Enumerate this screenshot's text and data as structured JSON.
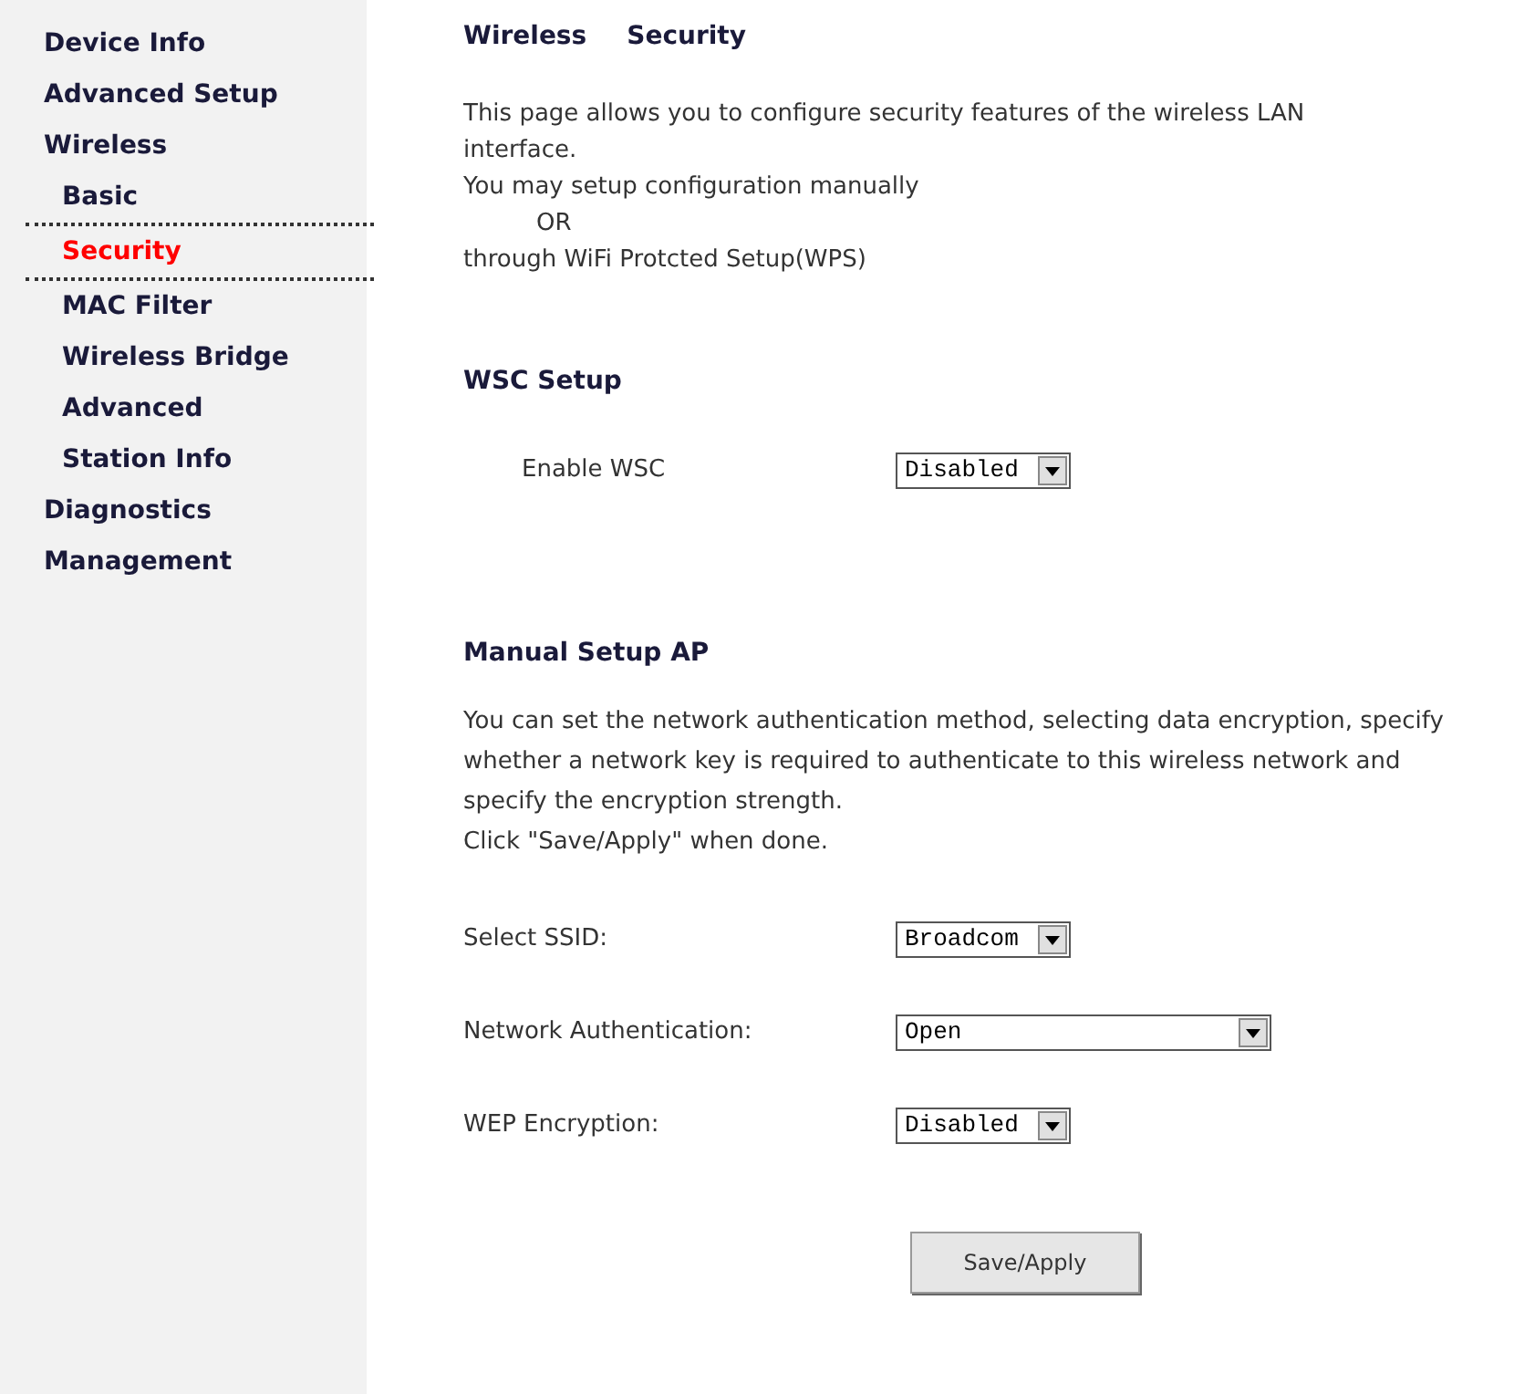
{
  "sidebar": {
    "items": [
      {
        "label": "Device Info",
        "selected": false
      },
      {
        "label": "Advanced Setup",
        "selected": false
      },
      {
        "label": "Wireless",
        "selected": false,
        "children": [
          {
            "label": "Basic",
            "selected": false
          },
          {
            "label": "Security",
            "selected": true
          },
          {
            "label": "MAC Filter",
            "selected": false
          },
          {
            "label": "Wireless Bridge",
            "selected": false
          },
          {
            "label": "Advanced",
            "selected": false
          },
          {
            "label": "Station Info",
            "selected": false
          }
        ]
      },
      {
        "label": "Diagnostics",
        "selected": false
      },
      {
        "label": "Management",
        "selected": false
      }
    ]
  },
  "title": [
    "Wireless",
    "Security"
  ],
  "intro": [
    "This page allows you to configure security features of the wireless LAN interface.",
    "You may setup configuration manually",
    "OR",
    "through WiFi Protcted Setup(WPS)"
  ],
  "wsc": {
    "heading": "WSC Setup",
    "fields": [
      {
        "label": "Enable WSC",
        "value": "Disabled",
        "wide": false
      }
    ]
  },
  "manual": {
    "heading": "Manual Setup AP",
    "description": [
      "You can set the network authentication method, selecting data encryption, specify whether a network key is required to authenticate to this wireless network and specify the encryption strength.",
      "Click \"Save/Apply\" when done."
    ],
    "fields": [
      {
        "label": "Select SSID:",
        "value": "Broadcom",
        "wide": false
      },
      {
        "label": "Network Authentication:",
        "value": "Open",
        "wide": true
      },
      {
        "label": "WEP Encryption:",
        "value": "Disabled",
        "wide": false
      }
    ]
  },
  "button": "Save/Apply"
}
